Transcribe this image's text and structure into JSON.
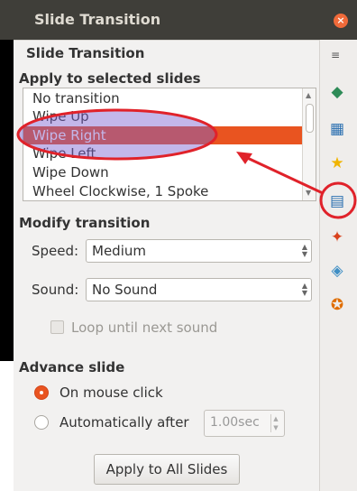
{
  "window": {
    "title": "Slide Transition",
    "close_glyph": "×"
  },
  "panel": {
    "title": "Slide Transition",
    "menu_glyph": "≡",
    "apply_heading": "Apply to selected slides",
    "transitions": [
      "No transition",
      "Wipe Up",
      "Wipe Right",
      "Wipe Left",
      "Wipe Down",
      "Wheel Clockwise, 1 Spoke"
    ],
    "selected_transition": "Wipe Right",
    "modify_heading": "Modify transition",
    "speed_label": "Speed:",
    "speed_value": "Medium",
    "sound_label": "Sound:",
    "sound_value": "No Sound",
    "loop_label": "Loop until next sound",
    "loop_checked": false,
    "advance_heading": "Advance slide",
    "advance_options": [
      {
        "label": "On mouse click",
        "selected": true
      },
      {
        "label": "Automatically after",
        "selected": false
      }
    ],
    "auto_delay": "1.00sec",
    "apply_all_button": "Apply to All Slides"
  },
  "sidebar": {
    "icons": [
      "properties-icon",
      "styles-icon",
      "gallery-icon",
      "navigator-icon",
      "slide-transition-icon",
      "custom-animation-icon",
      "master-slides-icon",
      "navigator-compass-icon"
    ],
    "active": "slide-transition-icon"
  },
  "colors": {
    "accent": "#e95420",
    "annotation": "#e0222a",
    "titlebar": "#3f3e39"
  }
}
